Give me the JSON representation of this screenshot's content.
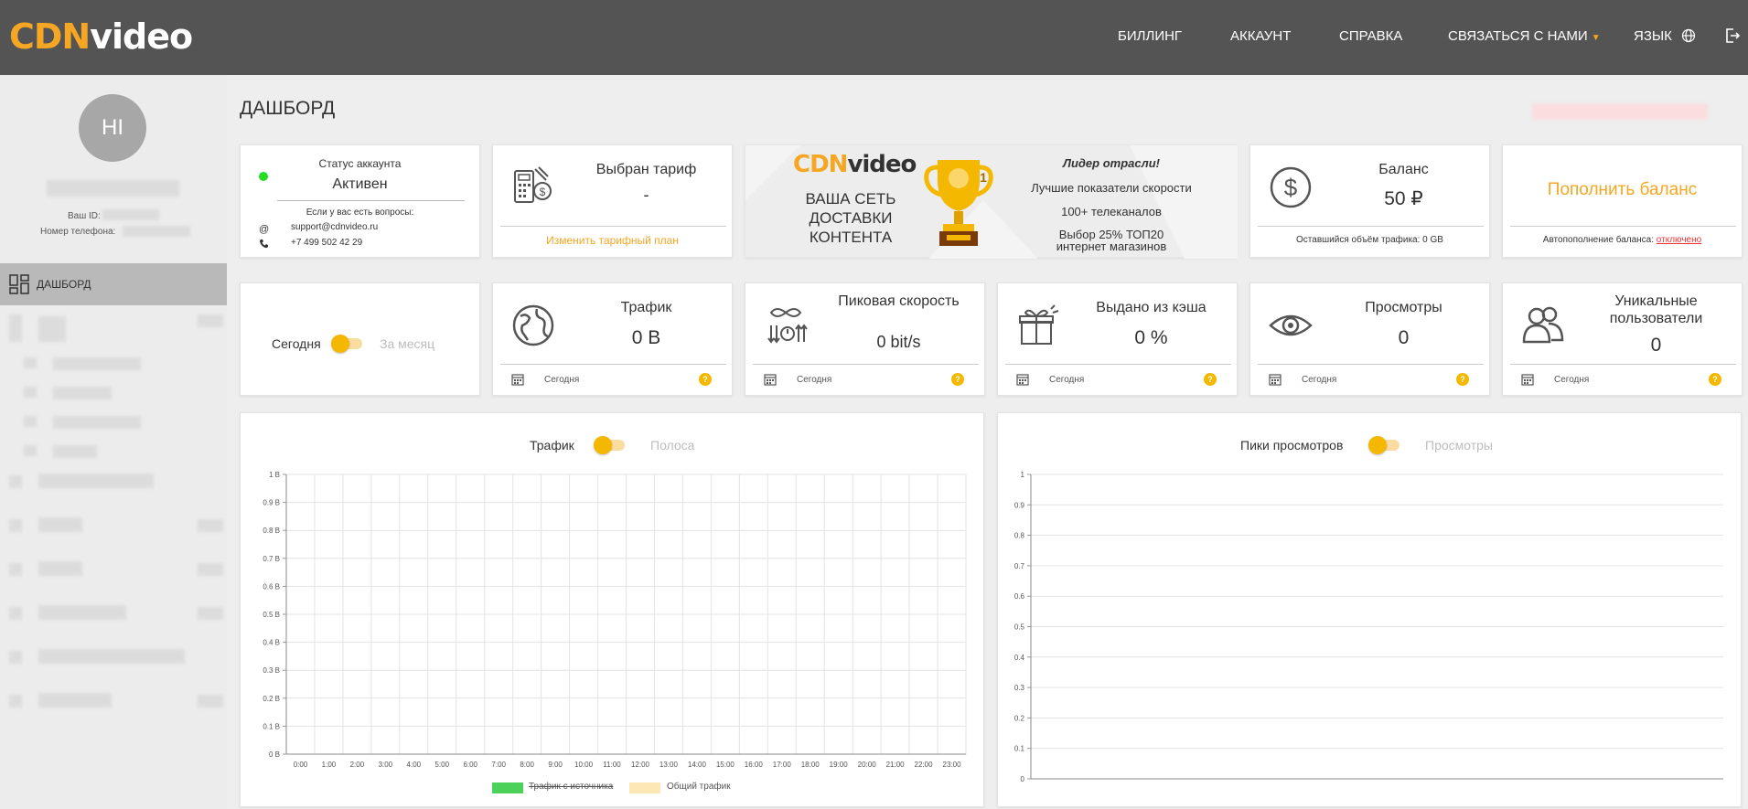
{
  "header": {
    "logo_cdn": "CDN",
    "logo_video": "video",
    "nav": {
      "billing": "БИЛЛИНГ",
      "account": "АККАУНТ",
      "help": "СПРАВКА",
      "contact": "СВЯЗАТЬСЯ С НАМИ",
      "language": "ЯЗЫК"
    }
  },
  "sidebar": {
    "avatar_initials": "HI",
    "user_id_label": "Ваш ID:",
    "phone_label": "Номер телефона:",
    "active_item": "ДАШБОРД"
  },
  "page": {
    "title": "ДАШБОРД"
  },
  "account_status": {
    "label": "Статус аккаунта",
    "value": "Активен",
    "questions": "Если у вас есть вопросы:",
    "email": "support@cdnvideo.ru",
    "phone": "+7 499 502 42 29"
  },
  "tariff": {
    "title": "Выбран тариф",
    "value": "-",
    "link": "Изменить тарифный план"
  },
  "banner": {
    "logo_cdn": "CDN",
    "logo_video": "video",
    "line1": "ВАША СЕТЬ",
    "line2": "ДОСТАВКИ",
    "line3": "КОНТЕНТА",
    "leader": "Лидер отрасли!",
    "point1": "Лучшие показатели скорости",
    "point2": "100+ телеканалов",
    "point3a": "Выбор 25% ТОП20",
    "point3b": "интернет магазинов",
    "trophy_number": "1"
  },
  "balance": {
    "title": "Баланс",
    "value": "50 ₽",
    "foot": "Оставшийся объём трафика: 0 GB"
  },
  "topup": {
    "title": "Пополнить баланс",
    "auto_label": "Автопополнение баланса:",
    "auto_value": "отключено"
  },
  "period": {
    "today": "Сегодня",
    "month": "За месяц"
  },
  "stats": [
    {
      "title": "Трафик",
      "value": "0 B",
      "foot": "Сегодня"
    },
    {
      "title": "Пиковая скорость",
      "value": "0 bit/s",
      "foot": "Сегодня"
    },
    {
      "title": "Выдано из кэша",
      "value": "0 %",
      "foot": "Сегодня"
    },
    {
      "title": "Просмотры",
      "value": "0",
      "foot": "Сегодня"
    },
    {
      "title": "Уникальные пользователи",
      "value": "0",
      "foot": "Сегодня"
    }
  ],
  "colors": {
    "accent": "#f5a623",
    "header_bg": "#545454",
    "legend_source": "#4cd25a",
    "legend_total": "#fde8b5"
  },
  "chart_data": [
    {
      "type": "line",
      "toggle_on": "Трафик",
      "toggle_off": "Полоса",
      "x": [
        "0:00",
        "1:00",
        "2:00",
        "3:00",
        "4:00",
        "5:00",
        "6:00",
        "7:00",
        "8:00",
        "9:00",
        "10:00",
        "11:00",
        "12:00",
        "13:00",
        "14:00",
        "15:00",
        "16:00",
        "17:00",
        "18:00",
        "19:00",
        "20:00",
        "21:00",
        "22:00",
        "23:00"
      ],
      "yticks": [
        "0 B",
        "0.1 B",
        "0.2 B",
        "0.3 B",
        "0.4 B",
        "0.5 B",
        "0.6 B",
        "0.7 B",
        "0.8 B",
        "0.9 B",
        "1 B"
      ],
      "ylim": [
        0,
        1
      ],
      "grid": true,
      "legend_position": "bottom",
      "series": [
        {
          "name": "Трафик с источника",
          "values": []
        },
        {
          "name": "Общий трафик",
          "values": []
        }
      ]
    },
    {
      "type": "line",
      "toggle_on": "Пики просмотров",
      "toggle_off": "Просмотры",
      "yticks": [
        "0",
        "0.1",
        "0.2",
        "0.3",
        "0.4",
        "0.5",
        "0.6",
        "0.7",
        "0.8",
        "0.9",
        "1"
      ],
      "ylim": [
        0,
        1
      ],
      "grid": true,
      "series": []
    }
  ]
}
